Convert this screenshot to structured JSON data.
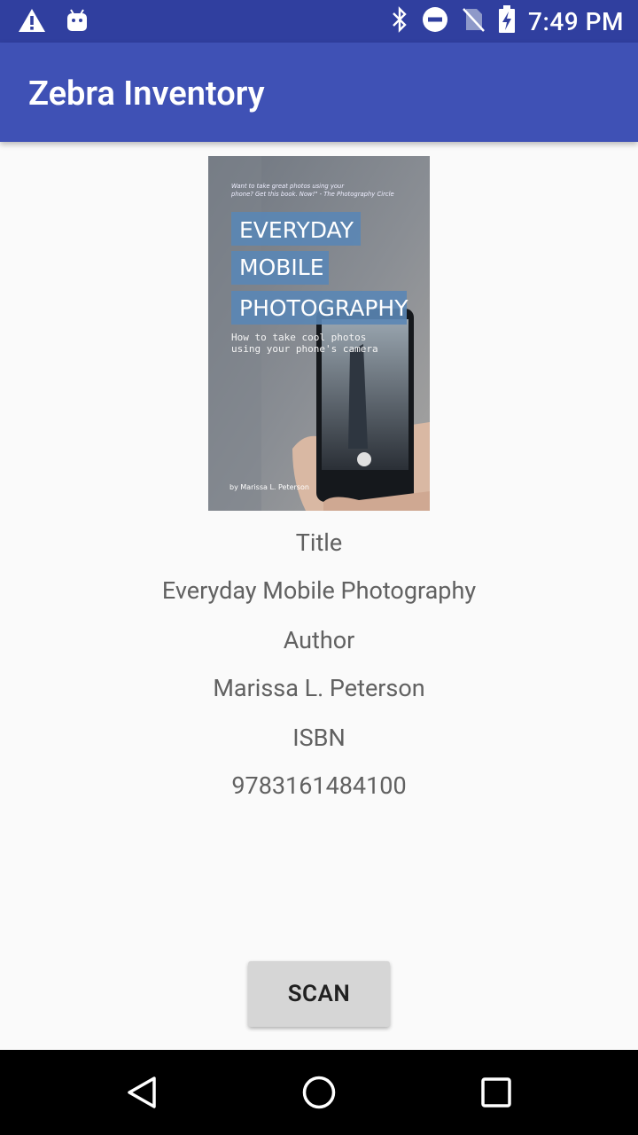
{
  "status": {
    "time": "7:49 PM"
  },
  "appbar": {
    "title": "Zebra Inventory"
  },
  "cover": {
    "quote_line1": "Want to take great photos using your",
    "quote_line2": "phone? Get this book. Now!\" - The Photography Circle",
    "title_line1": "EVERYDAY",
    "title_line2": "MOBILE",
    "title_line3": "PHOTOGRAPHY",
    "subtitle_line1": "How to take cool photos",
    "subtitle_line2": "using your phone's camera",
    "author": "by Marissa L. Peterson"
  },
  "book": {
    "title_label": "Title",
    "title_value": "Everyday Mobile Photography",
    "author_label": "Author",
    "author_value": "Marissa L. Peterson",
    "isbn_label": "ISBN",
    "isbn_value": "9783161484100"
  },
  "actions": {
    "scan_label": "SCAN"
  }
}
